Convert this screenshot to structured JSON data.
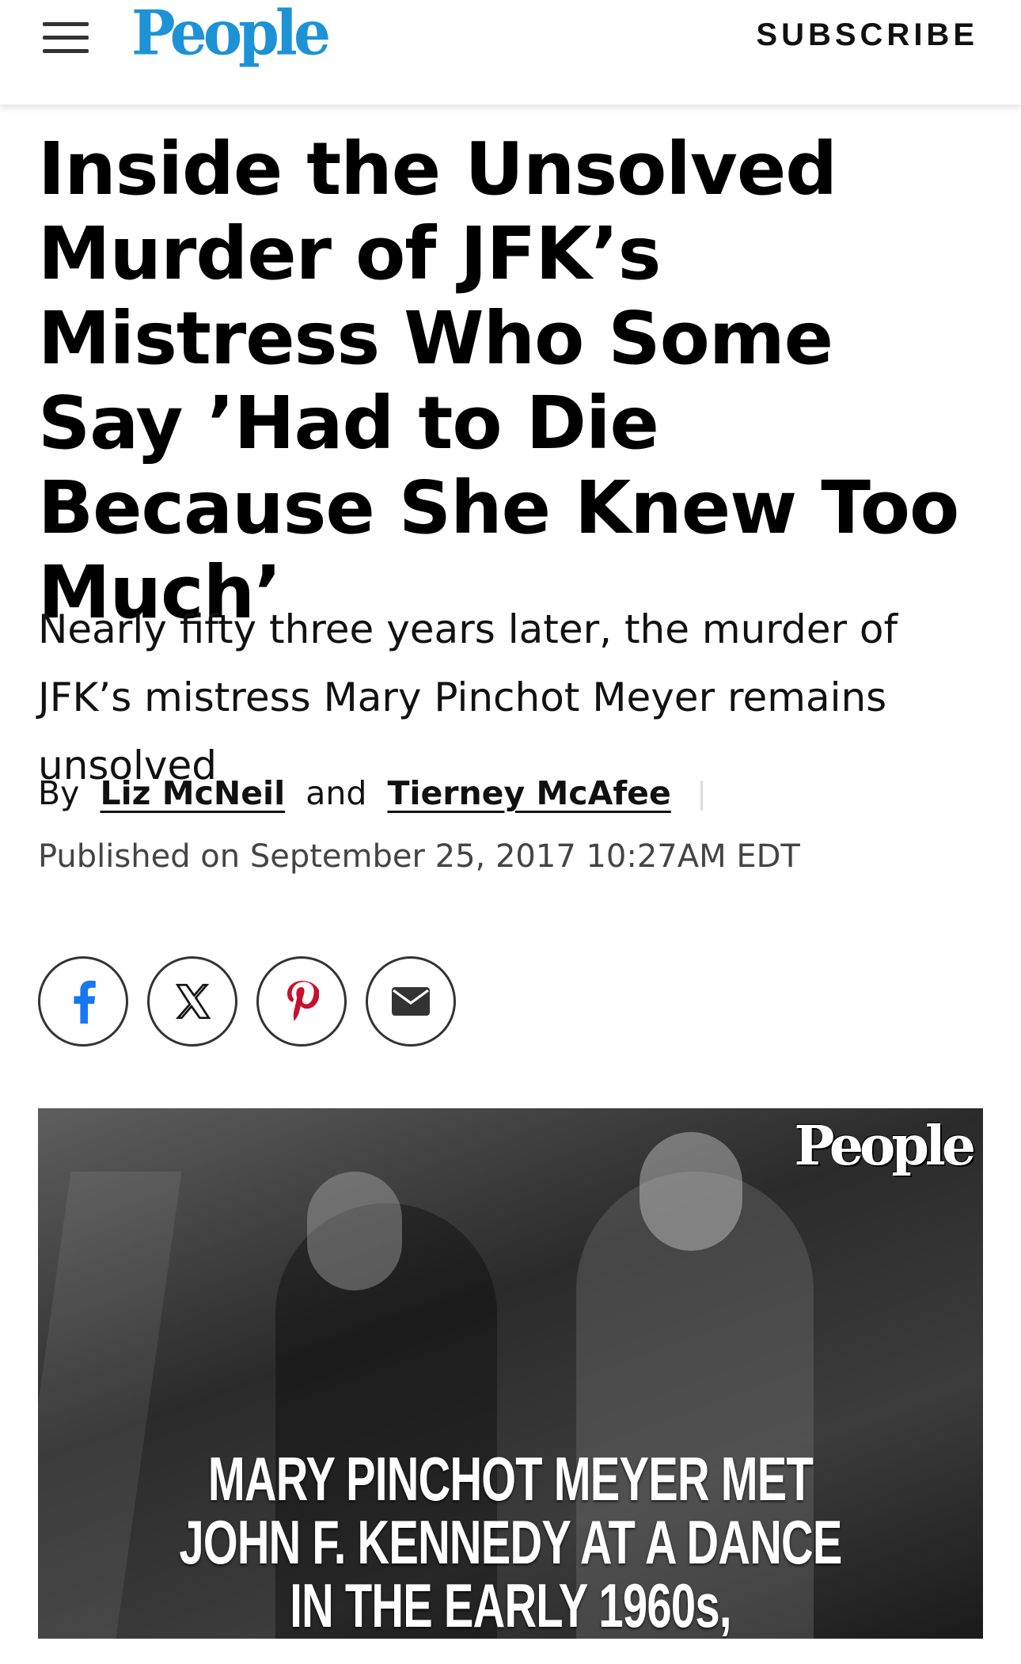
{
  "header": {
    "logo": "People",
    "subscribe_label": "SUBSCRIBE"
  },
  "article": {
    "title": "Inside the Unsolved Murder of JFK’s Mistress Who Some Say ’Had to Die Because She Knew Too Much’",
    "dek": "Nearly fifty three years later, the murder of JFK’s mistress Mary Pinchot Meyer remains unsolved",
    "byline": {
      "prefix": "By",
      "author1": "Liz McNeil",
      "conjunction": "and",
      "author2": "Tierney McAfee"
    },
    "published": "Published on September 25, 2017 10:27AM EDT"
  },
  "share": {
    "icons": [
      "facebook-icon",
      "x-icon",
      "pinterest-icon",
      "email-icon"
    ],
    "colors": {
      "facebook": "#1877f2",
      "pinterest": "#c8102e"
    }
  },
  "hero": {
    "watermark": "People",
    "caption": "MARY PINCHOT MEYER MET JOHN F. KENNEDY AT A DANCE IN THE EARLY 1960s,"
  },
  "colors": {
    "brand": "#1d93d5"
  }
}
